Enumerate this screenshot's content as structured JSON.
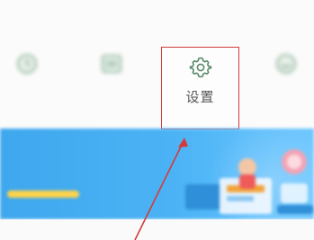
{
  "section": {
    "title": ""
  },
  "tools": [
    {
      "label": "",
      "icon": "clock-icon"
    },
    {
      "label": "",
      "icon": "card-icon"
    },
    {
      "label": "设置",
      "icon": "gear-icon"
    },
    {
      "label": "",
      "icon": "service-icon"
    }
  ],
  "banner": {
    "title": ""
  },
  "colors": {
    "highlight_border": "#d23b3b",
    "banner_blue": "#4bb3f5",
    "accent_yellow": "#ffd34a",
    "icon_green": "#7aa886"
  }
}
